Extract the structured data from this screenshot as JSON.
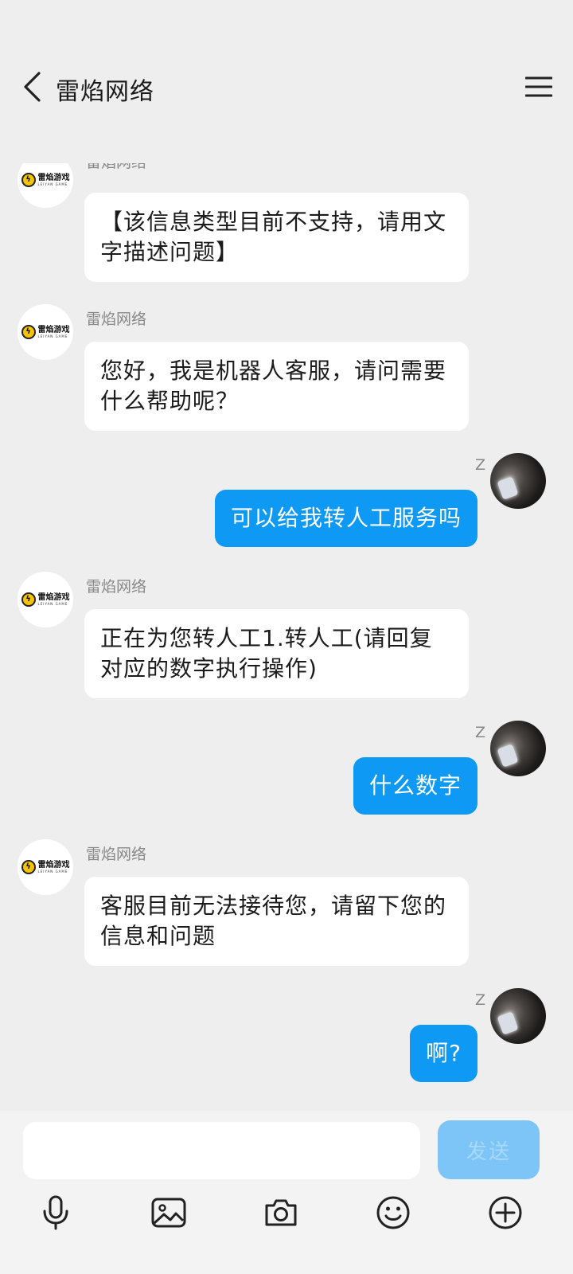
{
  "header": {
    "title": "雷焰网络"
  },
  "bot": {
    "logo_text": "雷焰游戏",
    "logo_subtext": "LEIYAN GAME",
    "logo_badge": "ϟ"
  },
  "messages": [
    {
      "from": "bot",
      "name": "雷焰网络",
      "text": "【该信息类型目前不支持，请用文字描述问题】"
    },
    {
      "from": "bot",
      "name": "雷焰网络",
      "text": "您好，我是机器人客服，请问需要什么帮助呢？"
    },
    {
      "from": "user",
      "name": "Z",
      "text": "可以给我转人工服务吗"
    },
    {
      "from": "bot",
      "name": "雷焰网络",
      "text": "正在为您转人工1.转人工(请回复对应的数字执行操作)"
    },
    {
      "from": "user",
      "name": "Z",
      "text": "什么数字"
    },
    {
      "from": "bot",
      "name": "雷焰网络",
      "text": "客服目前无法接待您，请留下您的信息和问题"
    },
    {
      "from": "user",
      "name": "Z",
      "text": "啊?"
    }
  ],
  "composer": {
    "placeholder": "",
    "value": "",
    "send_label": "发送"
  },
  "colors": {
    "background": "#eeeeee",
    "user_bubble": "#0e99f5",
    "send_button_disabled": "#7ec5f7"
  }
}
